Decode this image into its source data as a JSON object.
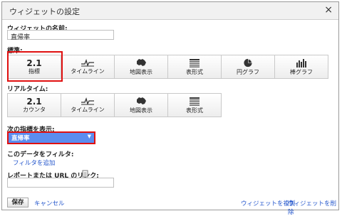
{
  "dialog": {
    "title": "ウィジェットの設定",
    "close": "×"
  },
  "widget_name": {
    "label": "ウィジェットの名前:",
    "value": "直帰率"
  },
  "standard": {
    "label": "標準:",
    "options": [
      {
        "value": "2.1",
        "label": "指標",
        "icon": "number-icon"
      },
      {
        "label": "タイムライン",
        "icon": "timeline-icon"
      },
      {
        "label": "地図表示",
        "icon": "map-icon"
      },
      {
        "label": "表形式",
        "icon": "table-icon"
      },
      {
        "label": "円グラフ",
        "icon": "pie-chart-icon"
      },
      {
        "label": "棒グラフ",
        "icon": "bar-chart-icon"
      }
    ]
  },
  "realtime": {
    "label": "リアルタイム:",
    "options": [
      {
        "value": "2.1",
        "label": "カウンタ",
        "icon": "number-icon"
      },
      {
        "label": "タイムライン",
        "icon": "timeline-icon"
      },
      {
        "label": "地図表示",
        "icon": "map-icon"
      },
      {
        "label": "表形式",
        "icon": "table-icon"
      }
    ]
  },
  "metric": {
    "label": "次の指標を表示:",
    "selected": "直帰率",
    "arrow": "▼"
  },
  "filter": {
    "label": "このデータをフィルタ:",
    "link": "フィルタを追加"
  },
  "report_link": {
    "label": "レポートまたは URL のリンク:",
    "value": ""
  },
  "footer": {
    "save": "保存",
    "cancel": "キャンセル",
    "copy": "ウィジェットを複製",
    "delete": "ウィジェットを削除"
  }
}
